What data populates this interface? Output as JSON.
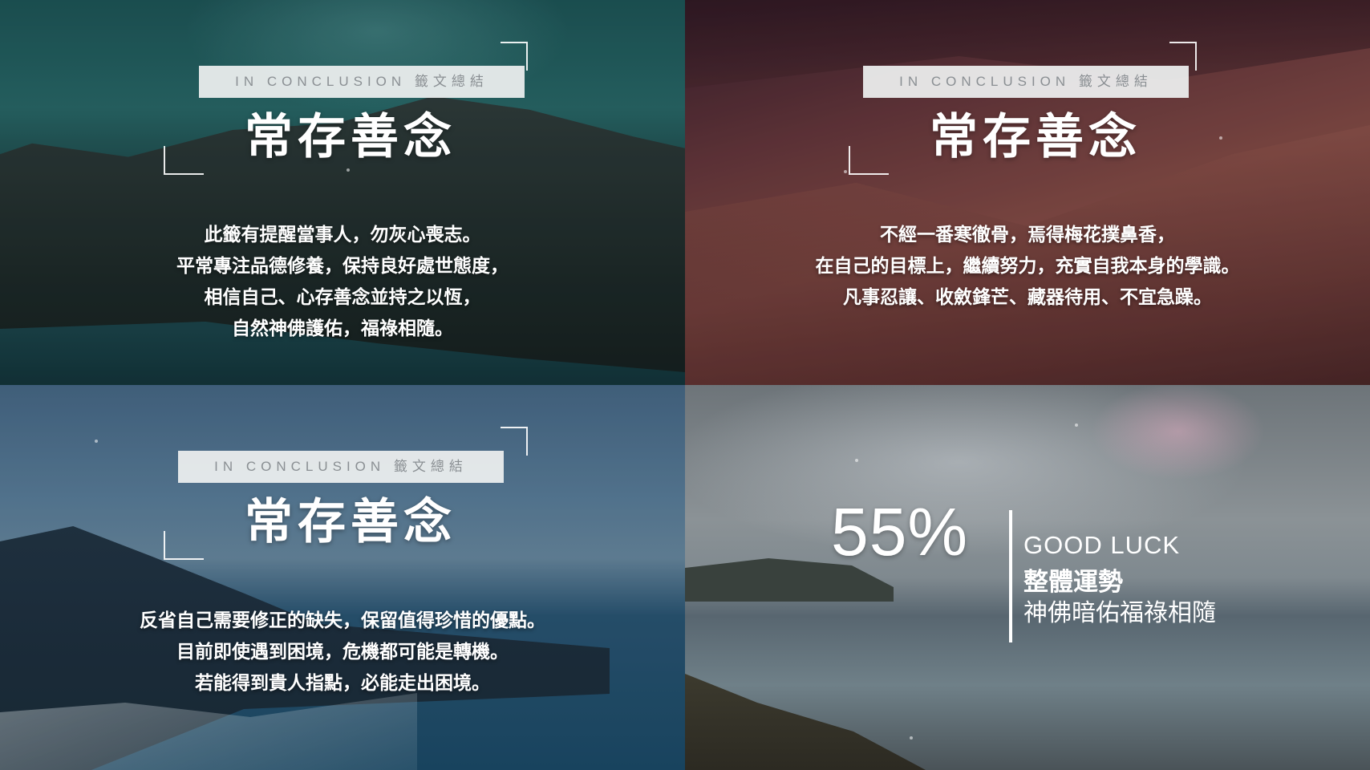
{
  "panels": [
    {
      "tag": "IN CONCLUSION 籤文總結",
      "title": "常存善念",
      "lines": [
        "此籤有提醒當事人，勿灰心喪志。",
        "平常專注品德修養，保持良好處世態度，",
        "相信自己、心存善念並持之以恆，",
        "自然神佛護佑，福祿相隨。"
      ]
    },
    {
      "tag": "IN CONCLUSION 籤文總結",
      "title": "常存善念",
      "lines": [
        "不經一番寒徹骨，焉得梅花撲鼻香，",
        "在自己的目標上，繼續努力，充實自我本身的學識。",
        "凡事忍讓、收斂鋒芒、藏器待用、不宜急躁。"
      ]
    },
    {
      "tag": "IN CONCLUSION 籤文總結",
      "title": "常存善念",
      "lines": [
        "反省自己需要修正的缺失，保留值得珍惜的優點。",
        "目前即使遇到困境，危機都可能是轉機。",
        "若能得到貴人指點，必能走出困境。"
      ]
    }
  ],
  "fortune": {
    "percent": "55%",
    "heading_en": "GOOD LUCK",
    "heading_zh": "整體運勢",
    "subtitle": "神佛暗佑福祿相隨"
  }
}
